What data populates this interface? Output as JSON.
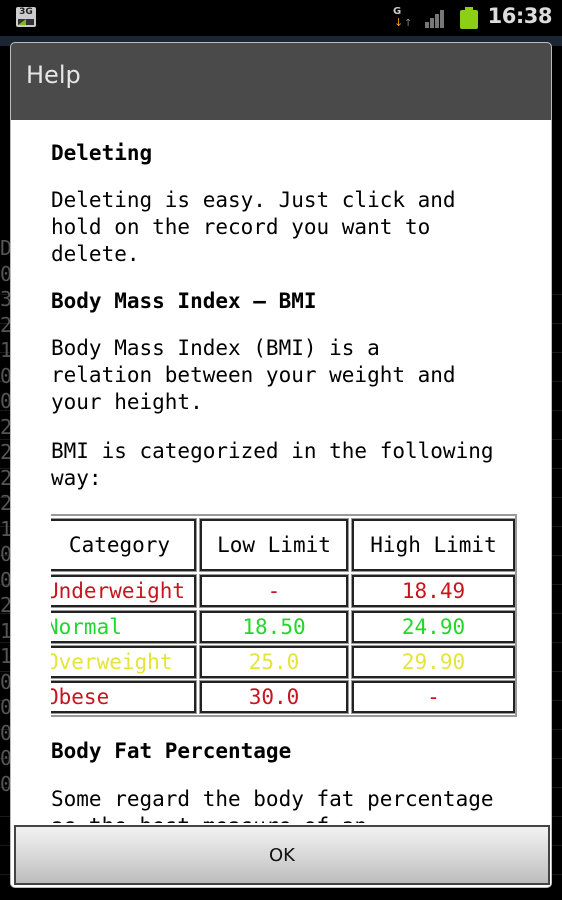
{
  "status_bar": {
    "network_label": "3G",
    "data_indicator": "G",
    "time": "16:38",
    "icons": [
      "3g-icon",
      "data-transfer-icon",
      "signal-icon",
      "battery-icon"
    ]
  },
  "background_app": {
    "visible_digits": [
      "D",
      "0",
      "3",
      "2",
      "1",
      "0",
      "0",
      "2",
      "2",
      "2",
      "2",
      "1",
      "0",
      "0",
      "2",
      "1",
      "1",
      "0",
      "0",
      "0",
      "0",
      "0"
    ]
  },
  "dialog": {
    "title": "Help",
    "sections": [
      {
        "heading": "Deleting",
        "paragraphs": [
          "Deleting is easy. Just click and\nhold on the record you want to\ndelete."
        ]
      },
      {
        "heading": "Body Mass Index – BMI",
        "paragraphs": [
          "Body Mass Index (BMI) is a\nrelation between your weight and\nyour height.",
          "BMI is categorized in the following\nway:"
        ]
      },
      {
        "heading": "Body Fat Percentage",
        "paragraphs": [
          "Some regard the body fat percentage\nas the best measure of an"
        ]
      }
    ],
    "bmi_table": {
      "headers": [
        "Category",
        "Low Limit",
        "High Limit"
      ],
      "rows": [
        {
          "category": "Underweight",
          "low": "-",
          "high": "18.49",
          "color": "#c8141e"
        },
        {
          "category": "Normal",
          "low": "18.50",
          "high": "24.90",
          "color": "#1fd82a"
        },
        {
          "category": "Overweight",
          "low": "25.0",
          "high": "29.90",
          "color": "#e4e43a"
        },
        {
          "category": "Obese",
          "low": "30.0",
          "high": "-",
          "color": "#c8141e"
        }
      ]
    },
    "ok_label": "OK"
  }
}
